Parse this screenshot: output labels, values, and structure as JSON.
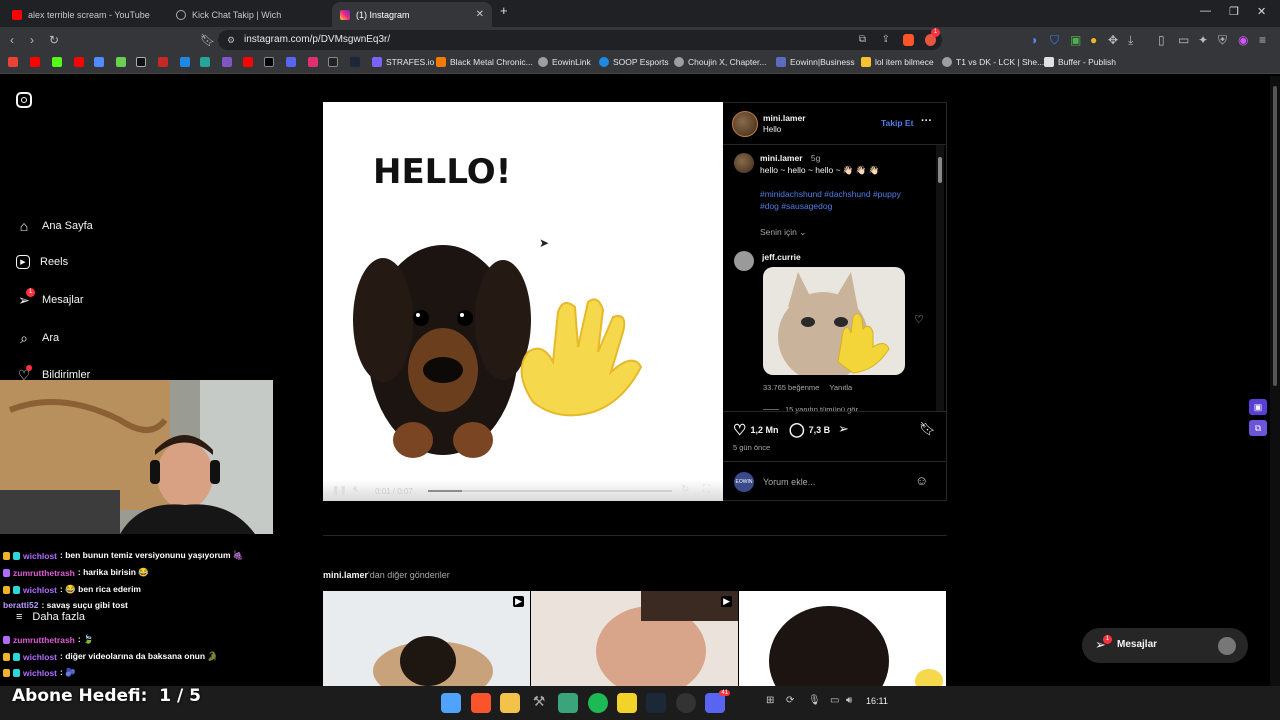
{
  "browser": {
    "tabs": [
      {
        "label": "alex terrible scream - YouTube",
        "color": "#ff0000"
      },
      {
        "label": "Kick Chat Takip | Wich",
        "color": "#9aa0a6"
      },
      {
        "label": "(1) Instagram",
        "color": "#e1306c"
      }
    ],
    "new_tab": "+",
    "url": "instagram.com/p/DVMsgwnEq3r/",
    "extension_badge": "1",
    "bookmarks": [
      {
        "label": "STRAFES.io",
        "color": "#7b61ff"
      },
      {
        "label": "Black Metal Chronic...",
        "color": "#f57c00"
      },
      {
        "label": "EowinLink",
        "color": "#9e9e9e"
      },
      {
        "label": "SOOP Esports",
        "color": "#1e88e5"
      },
      {
        "label": "Choujin X, Chapter...",
        "color": "#9e9e9e"
      },
      {
        "label": "Eowinn|Business",
        "color": "#5c6bc0"
      },
      {
        "label": "lol item bilmece",
        "color": "#fbc02d"
      },
      {
        "label": "T1 vs DK - LCK | She...",
        "color": "#9e9e9e"
      },
      {
        "label": "Buffer - Publish",
        "color": "#e0e0e0"
      }
    ]
  },
  "sidebar": {
    "items": [
      {
        "label": "Ana Sayfa",
        "icon": "home-icon"
      },
      {
        "label": "Reels",
        "icon": "reels-icon"
      },
      {
        "label": "Mesajlar",
        "icon": "messages-icon",
        "badge": "1"
      },
      {
        "label": "Ara",
        "icon": "search-icon"
      },
      {
        "label": "Bildirimler",
        "icon": "heart-icon"
      }
    ],
    "more_label": "Daha fazla"
  },
  "post": {
    "media_text": "HELLO!",
    "video_time": "0:01 / 0:07",
    "video_progress": 0.14,
    "author": "mini.lamer",
    "subtitle": "Hello",
    "follow_label": "Takip Et",
    "more_label": "···",
    "caption_user": "mini.lamer",
    "caption_age": "5g",
    "caption_text": "hello ~ hello ~ hello ~ 👋🏻 👋🏻 👋🏻",
    "hashtags_line1": "#minidachshund #dachshund #puppy",
    "hashtags_line2": "#dog #sausagedog",
    "for_you": "Senin için",
    "comment_user": "jeff.currie",
    "comment_likes": "33.765 beğenme",
    "comment_reply": "Yanıtla",
    "view_replies": "15 yanıtın tümünü gör",
    "likes": "1,2 Mn",
    "comments": "7,3 B",
    "posted": "5 gün önce",
    "comment_placeholder": "Yorum ekle...",
    "more_from_user": "mini.lamer",
    "more_from_suffix": "'dan diğer gönderiler"
  },
  "messages_float": {
    "label": "Mesajlar",
    "badge": "1"
  },
  "chat": [
    {
      "user": "wichlost",
      "text": ": ben bunun temiz versiyonunu yaşıyorum 🍇",
      "color": "#b26bff"
    },
    {
      "user": "zumrutthetrash",
      "text": ": harika birisin 😂",
      "color": "#e05bd6"
    },
    {
      "user": "wichlost",
      "text": ": 😂 ben rica ederim",
      "color": "#b26bff"
    },
    {
      "user": "beratti52",
      "text": ": savaş suçu gibi tost",
      "color": "#b89cff"
    },
    {
      "user": "zumrutthetrash",
      "text": ": 🍃",
      "color": "#e05bd6"
    },
    {
      "user": "wichlost",
      "text": ": diğer videolarına da baksana onun 🐊",
      "color": "#b26bff"
    },
    {
      "user": "wichlost",
      "text": ": 🫐",
      "color": "#b26bff"
    }
  ],
  "overlay": {
    "goal_label": "Abone Hedefi:",
    "goal_current": "1",
    "goal_total": "5",
    "goal_sep": "/"
  },
  "taskbar": {
    "time": "16:11",
    "discord_badge": "41"
  }
}
